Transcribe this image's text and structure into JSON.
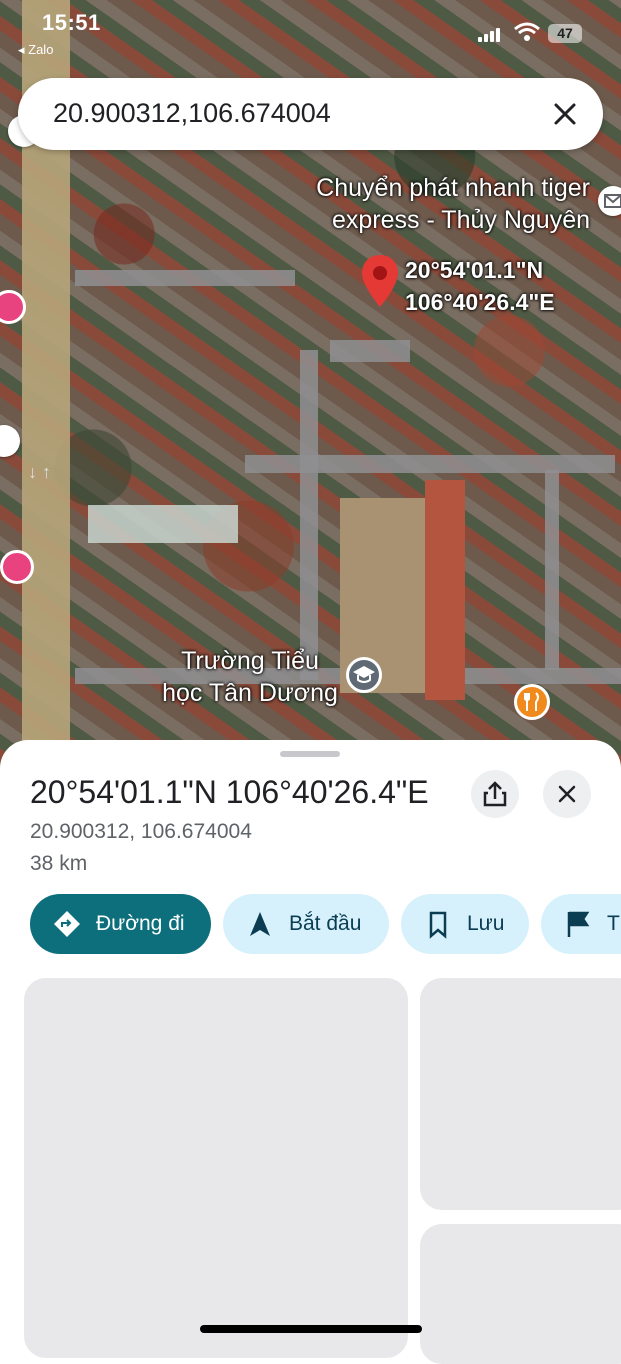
{
  "status_bar": {
    "time": "15:51",
    "back_app": "◂ Zalo",
    "battery": "47"
  },
  "search": {
    "query": "20.900312,106.674004"
  },
  "map": {
    "place_label": "Chuyển phát nhanh tiger express - Thủy Nguyên",
    "place_label_line1": "Chuyển phát nhanh tiger",
    "place_label_line2": "express - Thủy Nguyên",
    "pin_label_line1": "20°54'01.1\"N",
    "pin_label_line2": "106°40'26.4\"E",
    "school_label_line1": "Trường Tiểu",
    "school_label_line2": "học Tân Dương"
  },
  "sheet": {
    "title": "20°54'01.1\"N 106°40'26.4\"E",
    "decimal_coords": "20.900312, 106.674004",
    "distance": "38 km",
    "actions": {
      "directions": "Đường đi",
      "start": "Bắt đầu",
      "save": "Lưu",
      "more": "T"
    }
  },
  "colors": {
    "primary": "#0d6f7b",
    "chip": "#d6f1fb",
    "pin": "#e53935"
  }
}
